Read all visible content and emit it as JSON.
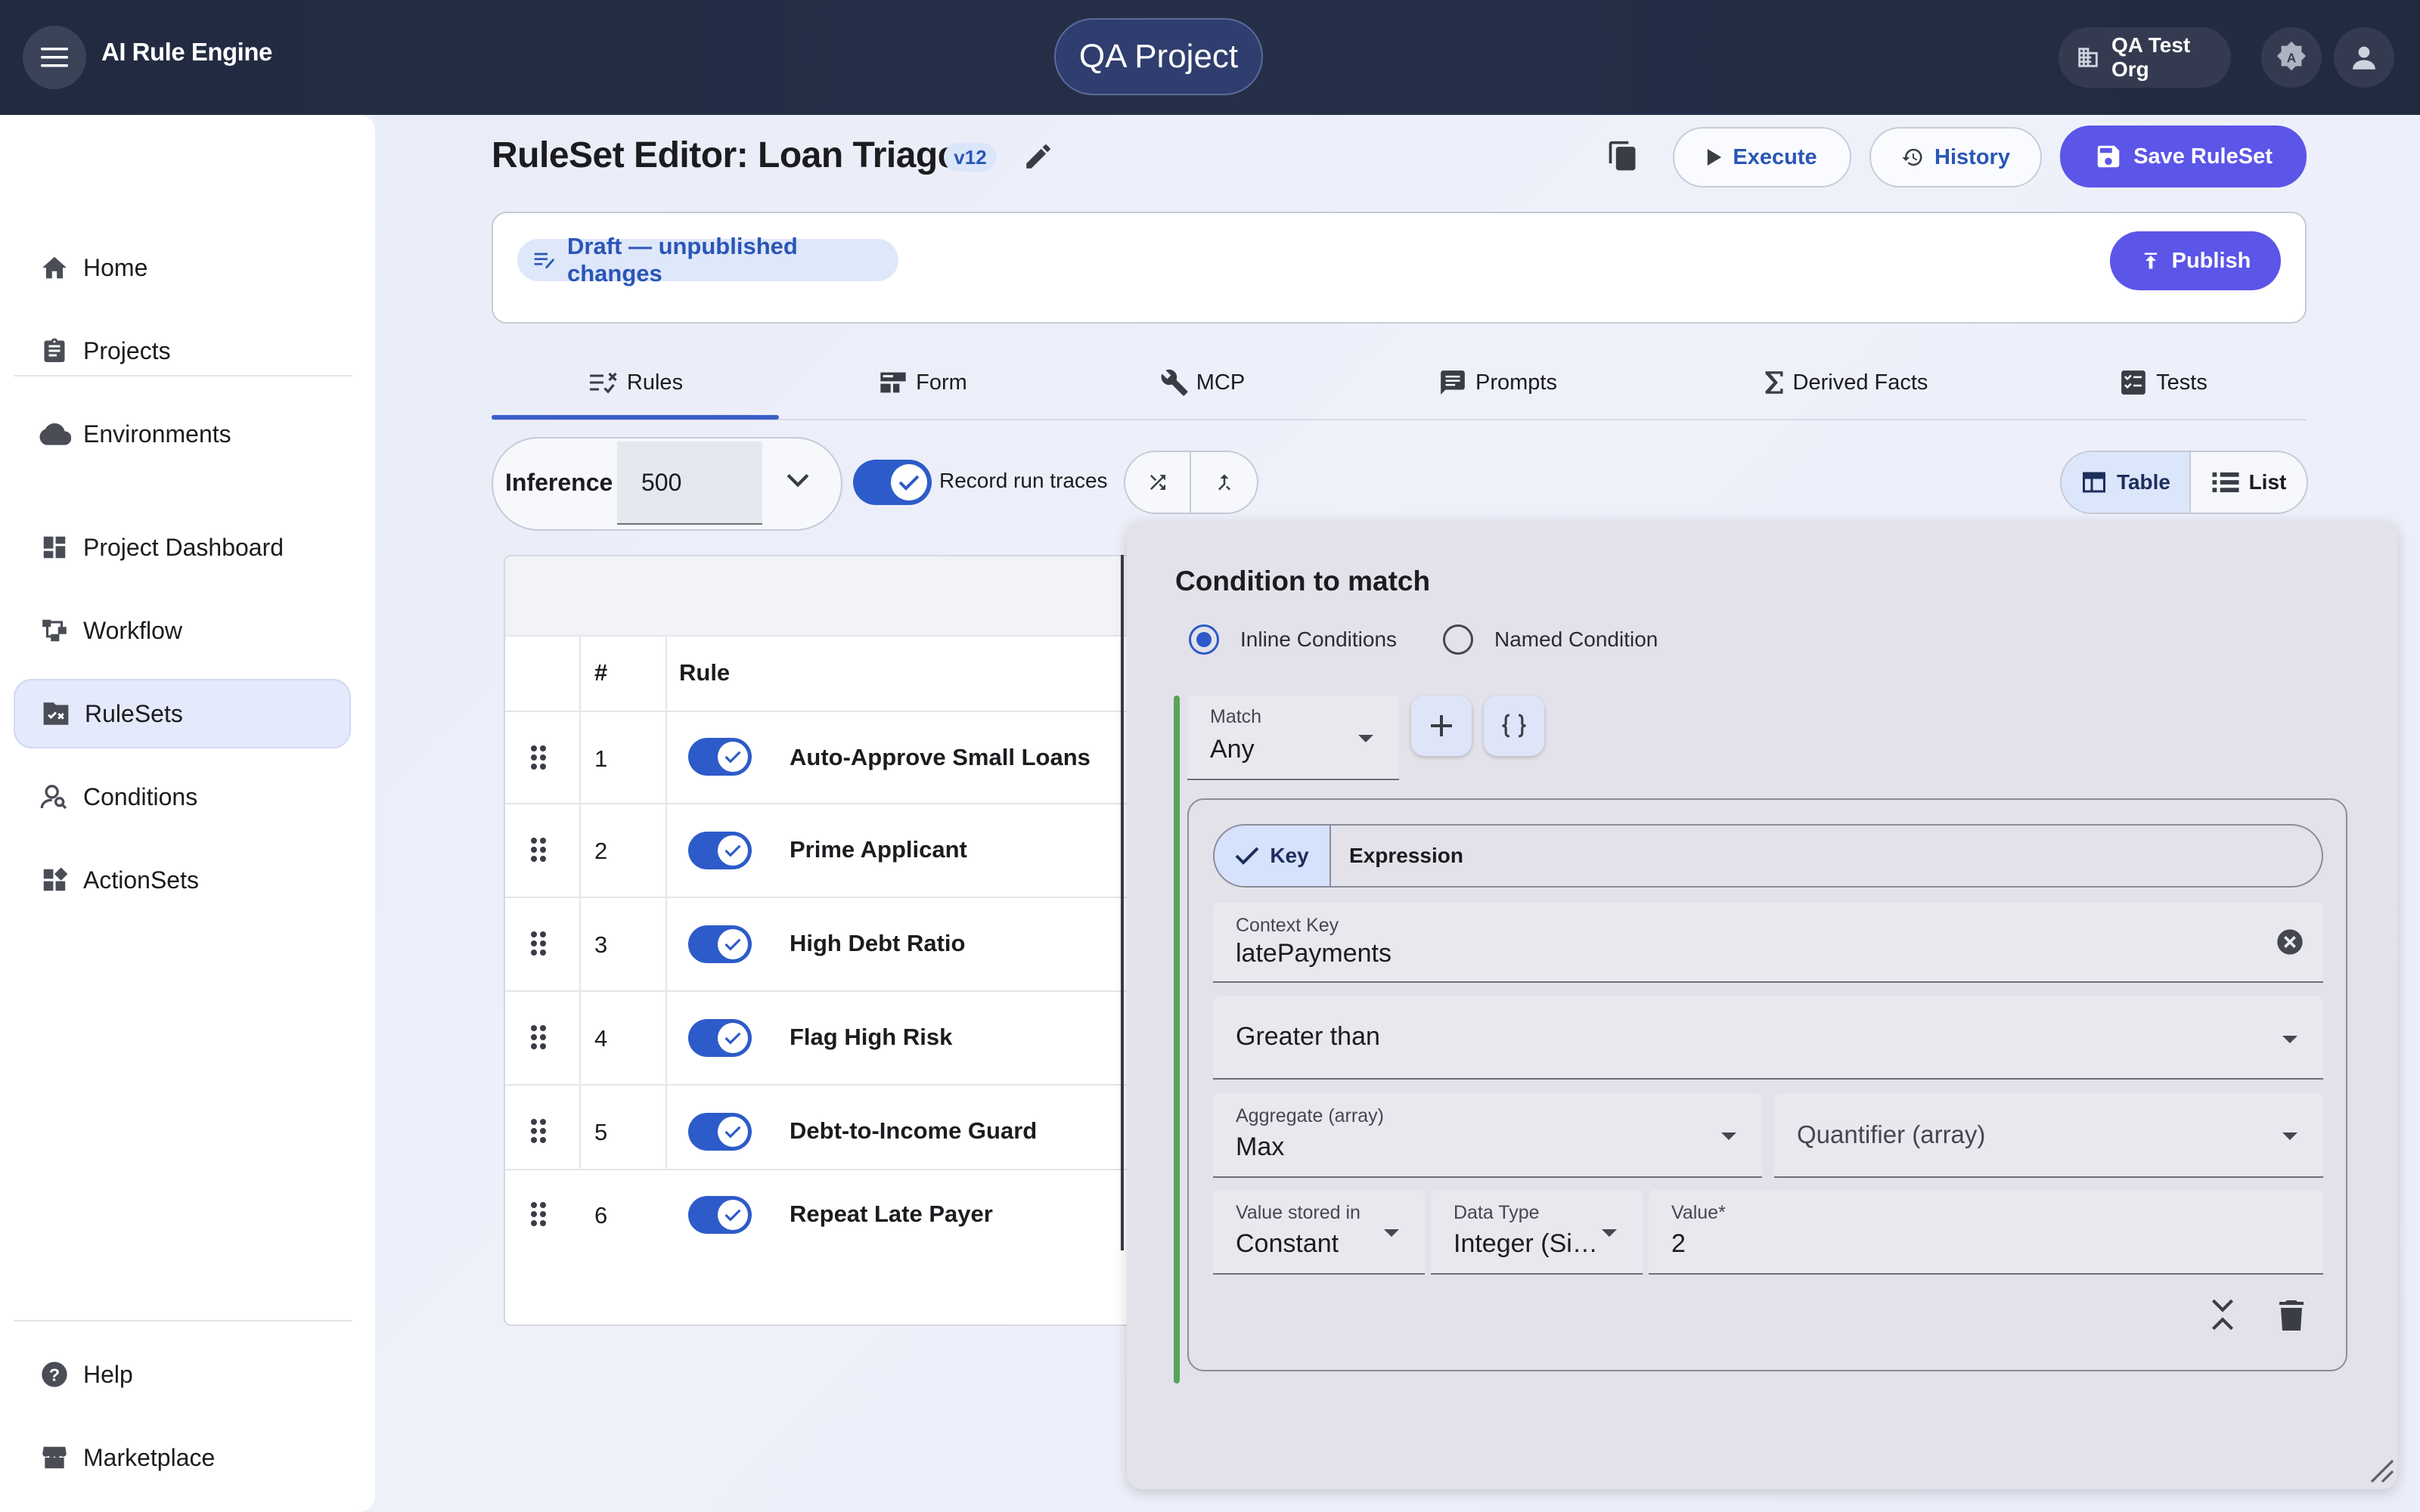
{
  "header": {
    "app_title": "AI Rule Engine",
    "project": "QA Project",
    "org": "QA Test Org"
  },
  "sidebar": {
    "items": [
      {
        "label": "Home",
        "icon": "home-icon"
      },
      {
        "label": "Projects",
        "icon": "clipboard-icon"
      },
      {
        "label": "Environments",
        "icon": "cloud-icon"
      },
      {
        "label": "Project Dashboard",
        "icon": "dashboard-icon"
      },
      {
        "label": "Workflow",
        "icon": "workflow-icon"
      },
      {
        "label": "RuleSets",
        "icon": "ruleset-icon",
        "active": true
      },
      {
        "label": "Conditions",
        "icon": "person-search-icon"
      },
      {
        "label": "ActionSets",
        "icon": "widgets-icon"
      },
      {
        "label": "Help",
        "icon": "help-icon"
      },
      {
        "label": "Marketplace",
        "icon": "store-icon"
      }
    ]
  },
  "editor": {
    "title": "RuleSet Editor: Loan Triage",
    "version": "v12",
    "execute_label": "Execute",
    "history_label": "History",
    "save_label": "Save RuleSet",
    "draft_label": "Draft — unpublished changes",
    "publish_label": "Publish"
  },
  "tabs": [
    {
      "label": "Rules",
      "icon": "rules-icon",
      "active": true
    },
    {
      "label": "Form",
      "icon": "form-icon"
    },
    {
      "label": "MCP",
      "icon": "wrench-icon"
    },
    {
      "label": "Prompts",
      "icon": "prompt-icon"
    },
    {
      "label": "Derived Facts",
      "icon": "sigma-icon"
    },
    {
      "label": "Tests",
      "icon": "tests-icon"
    }
  ],
  "toolbar": {
    "inference_label": "Inference",
    "inference_value": "500",
    "record_traces_label": "Record run traces",
    "record_traces_on": true,
    "view_table": "Table",
    "view_list": "List",
    "active_view": "Table"
  },
  "table": {
    "col_num": "#",
    "col_rule": "Rule",
    "rows": [
      {
        "num": "1",
        "name": "Auto-Approve Small Loans",
        "enabled": true
      },
      {
        "num": "2",
        "name": "Prime Applicant",
        "enabled": true
      },
      {
        "num": "3",
        "name": "High Debt Ratio",
        "enabled": true
      },
      {
        "num": "4",
        "name": "Flag High Risk",
        "enabled": true
      },
      {
        "num": "5",
        "name": "Debt-to-Income Guard",
        "enabled": true
      },
      {
        "num": "6",
        "name": "Repeat Late Payer",
        "enabled": true
      }
    ]
  },
  "condition": {
    "title": "Condition to match",
    "radio_inline": "Inline Conditions",
    "radio_named": "Named Condition",
    "selected_mode": "Inline Conditions",
    "match_label": "Match",
    "match_value": "Any",
    "seg_key": "Key",
    "seg_expression": "Expression",
    "context_key_label": "Context Key",
    "context_key_value": "latePayments",
    "operator_value": "Greater than",
    "aggregate_label": "Aggregate (array)",
    "aggregate_value": "Max",
    "quantifier_placeholder": "Quantifier (array)",
    "stored_in_label": "Value stored in",
    "stored_in_value": "Constant",
    "data_type_label": "Data Type",
    "data_type_value": "Integer (Si…",
    "value_label": "Value*",
    "value_value": "2"
  },
  "colors": {
    "topbar": "#222a40",
    "primary": "#5b55e8",
    "accent_blue": "#2d5bc9",
    "condition_border": "#5aa35a"
  }
}
